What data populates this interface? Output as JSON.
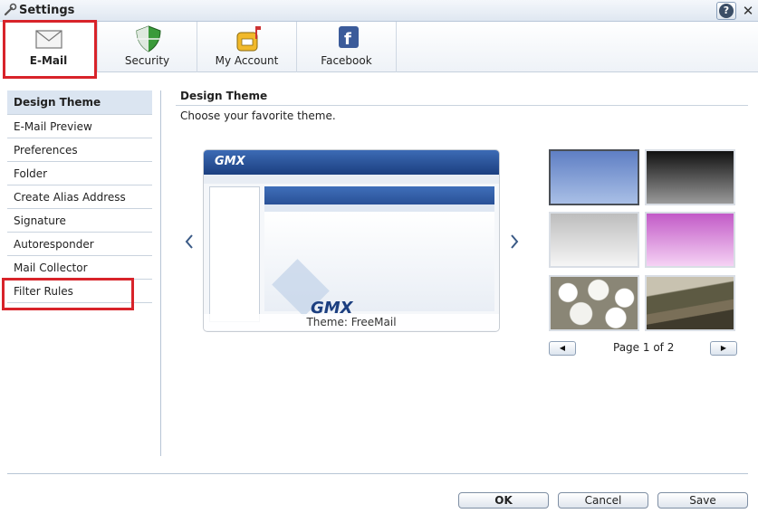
{
  "window": {
    "title": "Settings"
  },
  "tabs": [
    {
      "label": "E-Mail",
      "icon": "envelope-icon",
      "active": true
    },
    {
      "label": "Security",
      "icon": "shield-icon",
      "active": false
    },
    {
      "label": "My Account",
      "icon": "mailbox-icon",
      "active": false
    },
    {
      "label": "Facebook",
      "icon": "facebook-icon",
      "active": false
    }
  ],
  "nav": {
    "items": [
      {
        "label": "Design Theme",
        "active": true
      },
      {
        "label": "E-Mail Preview"
      },
      {
        "label": "Preferences"
      },
      {
        "label": "Folder"
      },
      {
        "label": "Create Alias Address"
      },
      {
        "label": "Signature"
      },
      {
        "label": "Autoresponder"
      },
      {
        "label": "Mail Collector"
      },
      {
        "label": "Filter Rules"
      }
    ]
  },
  "main": {
    "title": "Design Theme",
    "subtitle": "Choose your favorite theme.",
    "preview": {
      "logo": "GMX",
      "caption": "Theme: FreeMail"
    },
    "thumbnails": [
      "blue-gradient",
      "black-gradient",
      "gray-gradient",
      "pink-gradient",
      "white-pebbles-photo",
      "country-road-photo"
    ],
    "pager": "Page 1 of 2"
  },
  "footer": {
    "ok": "OK",
    "cancel": "Cancel",
    "save": "Save"
  },
  "colors": {
    "highlight": "#d8232a",
    "accent": "#1c3f80"
  }
}
